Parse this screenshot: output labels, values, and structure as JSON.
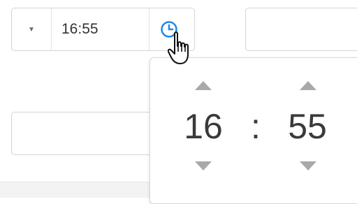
{
  "time_input": {
    "value": "16:55",
    "dropdown_glyph": "▼",
    "clock_icon": "clock-icon"
  },
  "time_picker": {
    "hours": "16",
    "separator": ":",
    "minutes": "55",
    "increment_icon": "triangle-up-icon",
    "decrement_icon": "triangle-down-icon"
  },
  "colors": {
    "accent": "#1e88e5",
    "border": "#d4d4d4",
    "arrow": "#a9a9a9",
    "text": "#3a3a3a"
  }
}
